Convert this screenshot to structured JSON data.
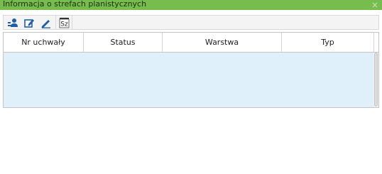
{
  "window": {
    "title": "Informacja o strefach planistycznych",
    "close_glyph": "×"
  },
  "toolbar": {
    "buttons": [
      {
        "icon": "locate-user-icon"
      },
      {
        "icon": "edit-form-icon"
      },
      {
        "icon": "pencil-icon"
      },
      {
        "icon": "sz-icon",
        "label": "Sz"
      }
    ]
  },
  "table": {
    "columns": [
      "Nr uchwały",
      "Status",
      "Warstwa",
      "Typ"
    ],
    "rows": []
  },
  "colors": {
    "titlebar": "#76bd4d",
    "body": "#dff0fb",
    "icon_blue": "#1f5fa8"
  }
}
